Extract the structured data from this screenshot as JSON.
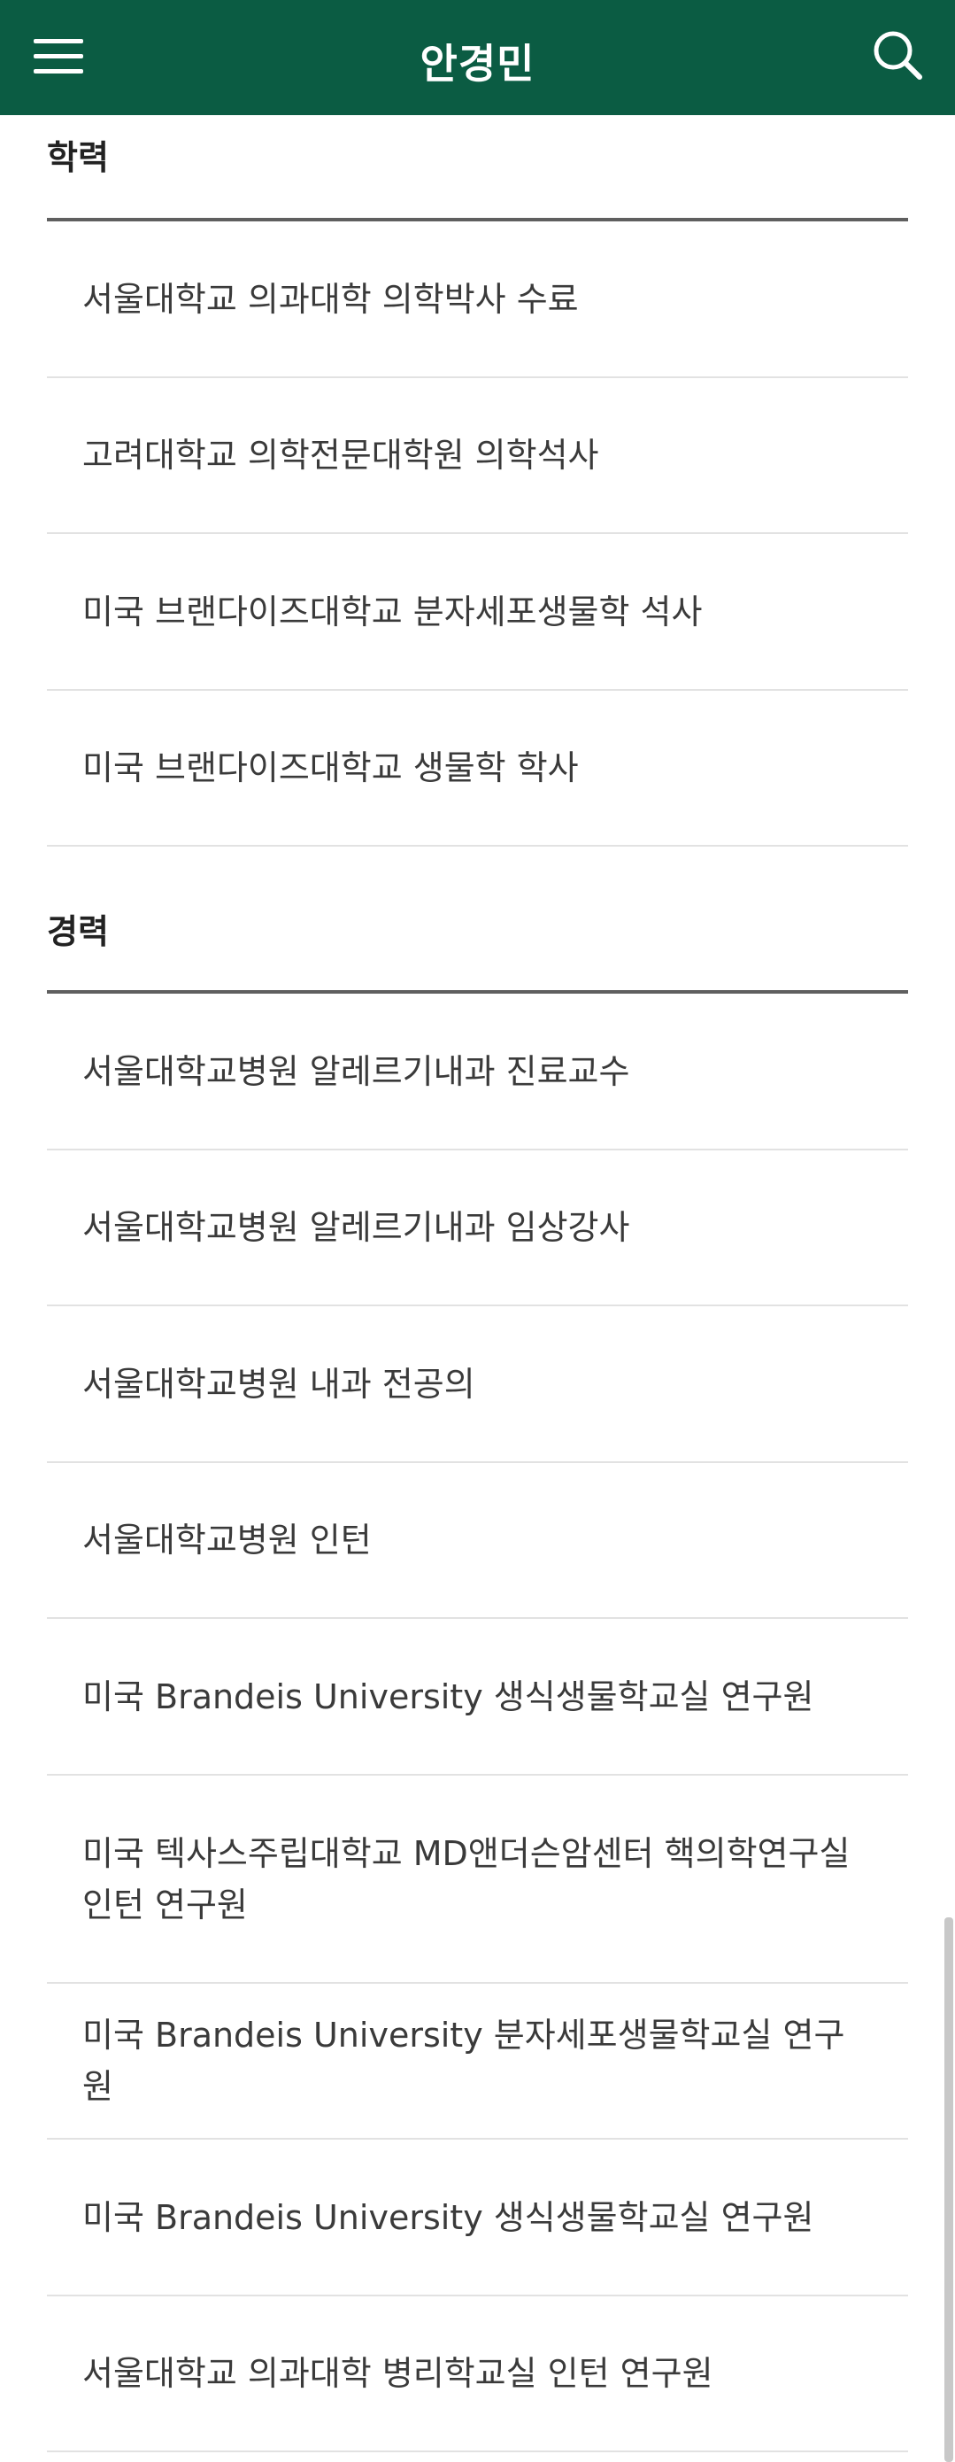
{
  "header": {
    "title": "안경민",
    "menu_icon": "hamburger-menu-icon",
    "search_icon": "search-icon",
    "background_color": "#0b5c43"
  },
  "education": {
    "heading": "학력",
    "items": [
      "서울대학교 의과대학 의학박사 수료",
      "고려대학교 의학전문대학원 의학석사",
      "미국 브랜다이즈대학교 분자세포생물학 석사",
      "미국 브랜다이즈대학교 생물학 학사"
    ]
  },
  "career": {
    "heading": "경력",
    "items": [
      "서울대학교병원 알레르기내과 진료교수",
      "서울대학교병원 알레르기내과 임상강사",
      "서울대학교병원 내과 전공의",
      "서울대학교병원 인턴",
      "미국 Brandeis University 생식생물학교실 연구원",
      "미국 텍사스주립대학교 MD앤더슨암센터 핵의학연구실 인턴 연구원",
      "미국 Brandeis University 분자세포생물학교실 연구원",
      "미국 Brandeis University 생식생물학교실 연구원",
      "서울대학교 의과대학 병리학교실 인턴 연구원"
    ]
  }
}
